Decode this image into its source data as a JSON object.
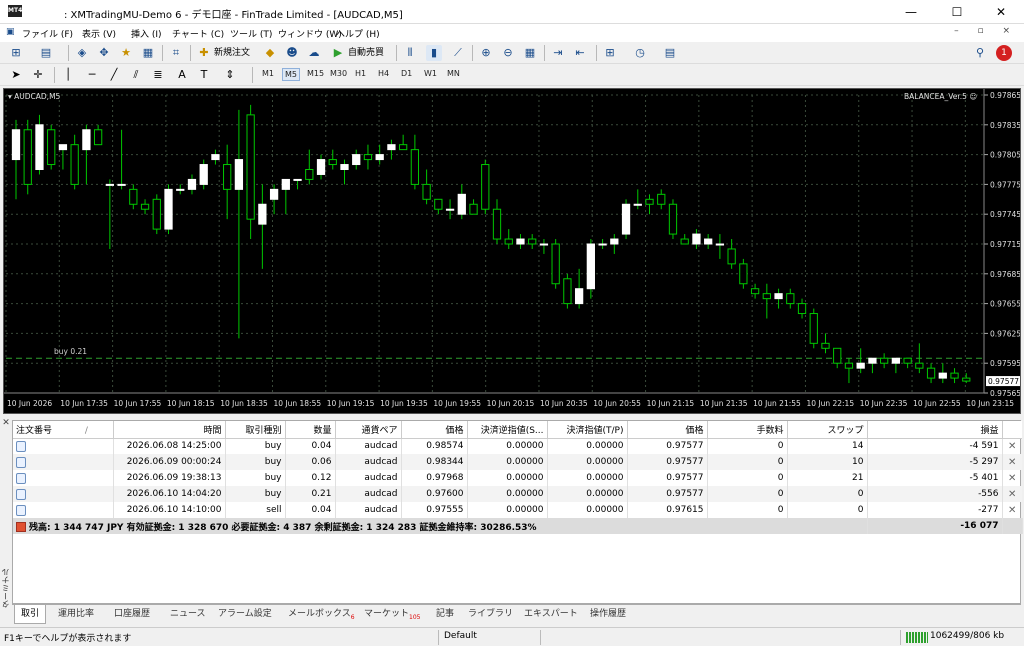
{
  "window": {
    "title": ": XMTradingMU-Demo 6 - デモ口座 - FinTrade Limited - [AUDCAD,M5]",
    "min": "—",
    "max": "☐",
    "close": "✕"
  },
  "menu": [
    "ファイル (F)",
    "表示 (V)",
    "挿入 (I)",
    "チャート (C)",
    "ツール (T)",
    "ウィンドウ (W)",
    "ヘルプ (H)"
  ],
  "toolbar": {
    "new_order": "新規注文",
    "auto_trading": "自動売買"
  },
  "timeframes": [
    "M1",
    "M5",
    "M15",
    "M30",
    "H1",
    "H4",
    "D1",
    "W1",
    "MN"
  ],
  "selected_timeframe": "M5",
  "notification_count": "1",
  "chart": {
    "symbol_label": "AUDCAD,M5",
    "ea_label": "BALANCEA_Ver.5 ☺",
    "order_line_label": "buy 0.21",
    "current_price": "0.97577",
    "bull_color": "#ffffff",
    "bear_color": "#000000",
    "wick_color": "#00c800",
    "grid_color": "#3a4a3a",
    "price_ticks": [
      "0.97865",
      "0.97835",
      "0.97805",
      "0.97775",
      "0.97745",
      "0.97715",
      "0.97685",
      "0.97655",
      "0.97625",
      "0.97595",
      "0.97565"
    ],
    "time_ticks": [
      "10 Jun 2026",
      "10 Jun 17:35",
      "10 Jun 17:55",
      "10 Jun 18:15",
      "10 Jun 18:35",
      "10 Jun 18:55",
      "10 Jun 19:15",
      "10 Jun 19:35",
      "10 Jun 19:55",
      "10 Jun 20:15",
      "10 Jun 20:35",
      "10 Jun 20:55",
      "10 Jun 21:15",
      "10 Jun 21:35",
      "10 Jun 21:55",
      "10 Jun 22:15",
      "10 Jun 22:35",
      "10 Jun 22:55",
      "10 Jun 23:15"
    ]
  },
  "chart_data": {
    "type": "candlestick",
    "ylim": [
      0.97565,
      0.97865
    ],
    "order_line_price": 0.976,
    "candles": [
      {
        "o": 0.978,
        "h": 0.9784,
        "l": 0.9776,
        "c": 0.9783
      },
      {
        "o": 0.9783,
        "h": 0.9784,
        "l": 0.97765,
        "c": 0.97775
      },
      {
        "o": 0.9779,
        "h": 0.97845,
        "l": 0.97785,
        "c": 0.97835
      },
      {
        "o": 0.9783,
        "h": 0.97835,
        "l": 0.9779,
        "c": 0.97795
      },
      {
        "o": 0.9781,
        "h": 0.97815,
        "l": 0.9779,
        "c": 0.97815
      },
      {
        "o": 0.97815,
        "h": 0.97825,
        "l": 0.9777,
        "c": 0.97775
      },
      {
        "o": 0.9781,
        "h": 0.97835,
        "l": 0.97775,
        "c": 0.9783
      },
      {
        "o": 0.9783,
        "h": 0.97835,
        "l": 0.97815,
        "c": 0.97815
      },
      {
        "o": 0.97775,
        "h": 0.9778,
        "l": 0.9771,
        "c": 0.97775
      },
      {
        "o": 0.97775,
        "h": 0.9783,
        "l": 0.9777,
        "c": 0.97775
      },
      {
        "o": 0.9777,
        "h": 0.97775,
        "l": 0.9775,
        "c": 0.97755
      },
      {
        "o": 0.97755,
        "h": 0.9776,
        "l": 0.97745,
        "c": 0.9775
      },
      {
        "o": 0.9776,
        "h": 0.97765,
        "l": 0.97725,
        "c": 0.9773
      },
      {
        "o": 0.9773,
        "h": 0.97775,
        "l": 0.97725,
        "c": 0.9777
      },
      {
        "o": 0.9777,
        "h": 0.97775,
        "l": 0.97765,
        "c": 0.9777
      },
      {
        "o": 0.9777,
        "h": 0.97785,
        "l": 0.97765,
        "c": 0.9778
      },
      {
        "o": 0.97775,
        "h": 0.978,
        "l": 0.9777,
        "c": 0.97795
      },
      {
        "o": 0.978,
        "h": 0.9781,
        "l": 0.97795,
        "c": 0.97805
      },
      {
        "o": 0.97795,
        "h": 0.97815,
        "l": 0.9774,
        "c": 0.9777
      },
      {
        "o": 0.9777,
        "h": 0.9785,
        "l": 0.9762,
        "c": 0.978
      },
      {
        "o": 0.97845,
        "h": 0.97855,
        "l": 0.9772,
        "c": 0.9774
      },
      {
        "o": 0.97735,
        "h": 0.97775,
        "l": 0.9769,
        "c": 0.97755
      },
      {
        "o": 0.9776,
        "h": 0.97775,
        "l": 0.97745,
        "c": 0.9777
      },
      {
        "o": 0.9777,
        "h": 0.9778,
        "l": 0.97745,
        "c": 0.9778
      },
      {
        "o": 0.9778,
        "h": 0.9778,
        "l": 0.9777,
        "c": 0.9778
      },
      {
        "o": 0.9779,
        "h": 0.9781,
        "l": 0.97775,
        "c": 0.9778
      },
      {
        "o": 0.97785,
        "h": 0.97805,
        "l": 0.9778,
        "c": 0.978
      },
      {
        "o": 0.978,
        "h": 0.9781,
        "l": 0.9779,
        "c": 0.97795
      },
      {
        "o": 0.9779,
        "h": 0.978,
        "l": 0.97775,
        "c": 0.97795
      },
      {
        "o": 0.97795,
        "h": 0.9781,
        "l": 0.9779,
        "c": 0.97805
      },
      {
        "o": 0.97805,
        "h": 0.97815,
        "l": 0.9779,
        "c": 0.978
      },
      {
        "o": 0.978,
        "h": 0.97815,
        "l": 0.97795,
        "c": 0.97805
      },
      {
        "o": 0.9781,
        "h": 0.9782,
        "l": 0.978,
        "c": 0.97815
      },
      {
        "o": 0.97815,
        "h": 0.97825,
        "l": 0.9781,
        "c": 0.9781
      },
      {
        "o": 0.9781,
        "h": 0.97825,
        "l": 0.9777,
        "c": 0.97775
      },
      {
        "o": 0.97775,
        "h": 0.9779,
        "l": 0.97755,
        "c": 0.9776
      },
      {
        "o": 0.9776,
        "h": 0.9776,
        "l": 0.97745,
        "c": 0.9775
      },
      {
        "o": 0.9775,
        "h": 0.9776,
        "l": 0.9774,
        "c": 0.9775
      },
      {
        "o": 0.97745,
        "h": 0.97775,
        "l": 0.9774,
        "c": 0.97765
      },
      {
        "o": 0.97755,
        "h": 0.9776,
        "l": 0.97745,
        "c": 0.97745
      },
      {
        "o": 0.97795,
        "h": 0.978,
        "l": 0.97745,
        "c": 0.9775
      },
      {
        "o": 0.9775,
        "h": 0.9776,
        "l": 0.97715,
        "c": 0.9772
      },
      {
        "o": 0.9772,
        "h": 0.9773,
        "l": 0.9771,
        "c": 0.97715
      },
      {
        "o": 0.97715,
        "h": 0.97725,
        "l": 0.9771,
        "c": 0.9772
      },
      {
        "o": 0.9772,
        "h": 0.97725,
        "l": 0.9771,
        "c": 0.97715
      },
      {
        "o": 0.97715,
        "h": 0.9772,
        "l": 0.97705,
        "c": 0.97715
      },
      {
        "o": 0.97715,
        "h": 0.9772,
        "l": 0.9767,
        "c": 0.97675
      },
      {
        "o": 0.9768,
        "h": 0.97685,
        "l": 0.9765,
        "c": 0.97655
      },
      {
        "o": 0.97655,
        "h": 0.9769,
        "l": 0.9765,
        "c": 0.9767
      },
      {
        "o": 0.9767,
        "h": 0.9772,
        "l": 0.9766,
        "c": 0.97715
      },
      {
        "o": 0.97715,
        "h": 0.9772,
        "l": 0.9771,
        "c": 0.97715
      },
      {
        "o": 0.97715,
        "h": 0.97725,
        "l": 0.97705,
        "c": 0.9772
      },
      {
        "o": 0.97725,
        "h": 0.9776,
        "l": 0.9772,
        "c": 0.97755
      },
      {
        "o": 0.97755,
        "h": 0.9777,
        "l": 0.9775,
        "c": 0.97755
      },
      {
        "o": 0.9776,
        "h": 0.97765,
        "l": 0.97745,
        "c": 0.97755
      },
      {
        "o": 0.97765,
        "h": 0.9777,
        "l": 0.9775,
        "c": 0.97755
      },
      {
        "o": 0.97755,
        "h": 0.9776,
        "l": 0.9772,
        "c": 0.97725
      },
      {
        "o": 0.9772,
        "h": 0.97725,
        "l": 0.97715,
        "c": 0.97715
      },
      {
        "o": 0.97715,
        "h": 0.9773,
        "l": 0.9771,
        "c": 0.97725
      },
      {
        "o": 0.97715,
        "h": 0.97725,
        "l": 0.9771,
        "c": 0.9772
      },
      {
        "o": 0.97715,
        "h": 0.97725,
        "l": 0.977,
        "c": 0.97715
      },
      {
        "o": 0.9771,
        "h": 0.9772,
        "l": 0.9769,
        "c": 0.97695
      },
      {
        "o": 0.97695,
        "h": 0.977,
        "l": 0.9767,
        "c": 0.97675
      },
      {
        "o": 0.9767,
        "h": 0.97675,
        "l": 0.9766,
        "c": 0.97665
      },
      {
        "o": 0.97665,
        "h": 0.97675,
        "l": 0.9764,
        "c": 0.9766
      },
      {
        "o": 0.9766,
        "h": 0.9767,
        "l": 0.9765,
        "c": 0.97665
      },
      {
        "o": 0.97665,
        "h": 0.9767,
        "l": 0.9765,
        "c": 0.97655
      },
      {
        "o": 0.97655,
        "h": 0.9766,
        "l": 0.9764,
        "c": 0.97645
      },
      {
        "o": 0.97645,
        "h": 0.9765,
        "l": 0.9761,
        "c": 0.97615
      },
      {
        "o": 0.97615,
        "h": 0.97625,
        "l": 0.97605,
        "c": 0.9761
      },
      {
        "o": 0.9761,
        "h": 0.9761,
        "l": 0.9759,
        "c": 0.97595
      },
      {
        "o": 0.97595,
        "h": 0.976,
        "l": 0.97575,
        "c": 0.9759
      },
      {
        "o": 0.9759,
        "h": 0.9761,
        "l": 0.97585,
        "c": 0.97595
      },
      {
        "o": 0.97595,
        "h": 0.976,
        "l": 0.97585,
        "c": 0.976
      },
      {
        "o": 0.976,
        "h": 0.97605,
        "l": 0.9759,
        "c": 0.97595
      },
      {
        "o": 0.97595,
        "h": 0.976,
        "l": 0.97585,
        "c": 0.976
      },
      {
        "o": 0.976,
        "h": 0.976,
        "l": 0.9759,
        "c": 0.97595
      },
      {
        "o": 0.97595,
        "h": 0.97615,
        "l": 0.97585,
        "c": 0.9759
      },
      {
        "o": 0.9759,
        "h": 0.97595,
        "l": 0.97575,
        "c": 0.9758
      },
      {
        "o": 0.9758,
        "h": 0.97595,
        "l": 0.97575,
        "c": 0.97585
      },
      {
        "o": 0.97585,
        "h": 0.9759,
        "l": 0.97575,
        "c": 0.9758
      },
      {
        "o": 0.9758,
        "h": 0.97585,
        "l": 0.97575,
        "c": 0.97577
      }
    ]
  },
  "terminal": {
    "vertical_label": "ターミナル",
    "headers": [
      "注文番号",
      "時間",
      "取引種別",
      "数量",
      "通貨ペア",
      "価格",
      "決済逆指値(S...",
      "決済指値(T/P)",
      "価格",
      "手数料",
      "スワップ",
      "損益"
    ],
    "sort_indicator": "/",
    "rows": [
      [
        "",
        "2026.06.08 14:25:00",
        "buy",
        "0.04",
        "audcad",
        "0.98574",
        "0.00000",
        "0.00000",
        "0.97577",
        "0",
        "14",
        "-4 591"
      ],
      [
        "",
        "2026.06.09 00:00:24",
        "buy",
        "0.06",
        "audcad",
        "0.98344",
        "0.00000",
        "0.00000",
        "0.97577",
        "0",
        "10",
        "-5 297"
      ],
      [
        "",
        "2026.06.09 19:38:13",
        "buy",
        "0.12",
        "audcad",
        "0.97968",
        "0.00000",
        "0.00000",
        "0.97577",
        "0",
        "21",
        "-5 401"
      ],
      [
        "",
        "2026.06.10 14:04:20",
        "buy",
        "0.21",
        "audcad",
        "0.97600",
        "0.00000",
        "0.00000",
        "0.97577",
        "0",
        "0",
        "-556"
      ],
      [
        "",
        "2026.06.10 14:10:00",
        "sell",
        "0.04",
        "audcad",
        "0.97555",
        "0.00000",
        "0.00000",
        "0.97615",
        "0",
        "0",
        "-277"
      ]
    ],
    "summary": "残高: 1 344 747 JPY  有効証拠金: 1 328 670  必要証拠金: 4 387  余剰証拠金: 1 324 283  証拠金維持率: 30286.53%",
    "summary_total": "-16 077",
    "tabs": [
      {
        "label": "取引",
        "badge": ""
      },
      {
        "label": "運用比率",
        "badge": ""
      },
      {
        "label": "口座履歴",
        "badge": ""
      },
      {
        "label": "ニュース",
        "badge": ""
      },
      {
        "label": "アラーム設定",
        "badge": ""
      },
      {
        "label": "メールボックス",
        "badge": "6"
      },
      {
        "label": "マーケット",
        "badge": "105"
      },
      {
        "label": "記事",
        "badge": ""
      },
      {
        "label": "ライブラリ",
        "badge": ""
      },
      {
        "label": "エキスパート",
        "badge": ""
      },
      {
        "label": "操作履歴",
        "badge": ""
      }
    ]
  },
  "status": {
    "help": "F1キーでヘルプが表示されます",
    "profile": "Default",
    "traffic": "1062499/806 kb"
  }
}
